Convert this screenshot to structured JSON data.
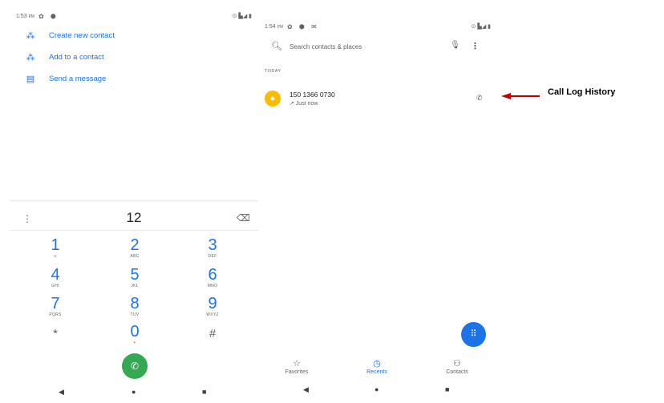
{
  "left": {
    "status": {
      "time": "1:53",
      "ampm": "PM",
      "icons": "✿ ⬢",
      "right": "⊙ ▙◢ ▮"
    },
    "menu": [
      {
        "icon": "person-add-icon",
        "glyph": "⁂",
        "label": "Create new contact"
      },
      {
        "icon": "person-add-icon",
        "glyph": "⁂",
        "label": "Add to a contact"
      },
      {
        "icon": "message-icon",
        "glyph": "▤",
        "label": "Send a message"
      }
    ],
    "dialpad": {
      "number": "12",
      "keys": [
        {
          "d": "1",
          "l": "∞"
        },
        {
          "d": "2",
          "l": "ABC"
        },
        {
          "d": "3",
          "l": "DEF"
        },
        {
          "d": "4",
          "l": "GHI"
        },
        {
          "d": "5",
          "l": "JKL"
        },
        {
          "d": "6",
          "l": "MNO"
        },
        {
          "d": "7",
          "l": "PQRS"
        },
        {
          "d": "8",
          "l": "TUV"
        },
        {
          "d": "9",
          "l": "WXYZ"
        },
        {
          "d": "*",
          "l": ""
        },
        {
          "d": "0",
          "l": "+"
        },
        {
          "d": "#",
          "l": ""
        }
      ]
    }
  },
  "right": {
    "status": {
      "time": "1:54",
      "ampm": "PM",
      "icons": "✿ ⬢ ✉",
      "right": "⊙ ▙◢ ▮"
    },
    "search_placeholder": "Search contacts & places",
    "section": "TODAY",
    "call": {
      "number": "150 1366 0730",
      "time": "↗ Just now"
    },
    "tabs": [
      {
        "label": "Favorites",
        "glyph": "☆"
      },
      {
        "label": "Recents",
        "glyph": "◷"
      },
      {
        "label": "Contacts",
        "glyph": "⚇"
      }
    ]
  },
  "annotation": {
    "label": "Call Log History",
    "color": "#c00000"
  },
  "colors": {
    "accent": "#1a73e8",
    "call_green": "#34a853",
    "avatar_yellow": "#fbbc04"
  },
  "nav": {
    "back": "◀",
    "home": "●",
    "recents": "■"
  }
}
